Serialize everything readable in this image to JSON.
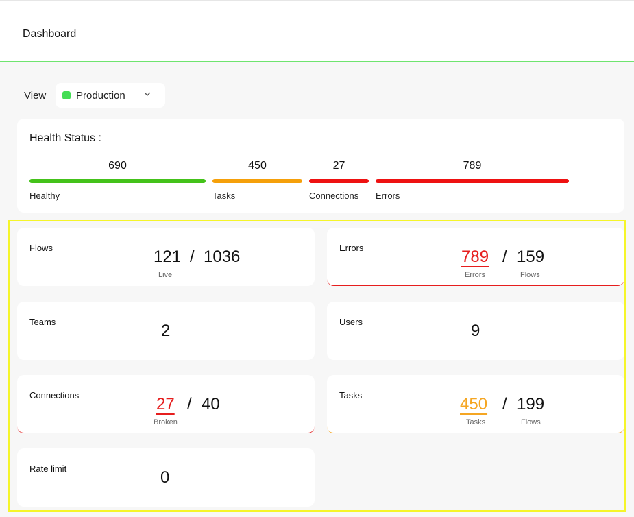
{
  "header": {
    "title": "Dashboard"
  },
  "view": {
    "label": "View",
    "selected": "Production",
    "status_color": "#44dd55"
  },
  "health": {
    "title": "Health Status :",
    "segments": [
      {
        "value": "690",
        "label": "Healthy",
        "color": "#44c21a"
      },
      {
        "value": "450",
        "label": "Tasks",
        "color": "#f5a00a"
      },
      {
        "value": "27",
        "label": "Connections",
        "color": "#ee1111"
      },
      {
        "value": "789",
        "label": "Errors",
        "color": "#ee1111"
      }
    ]
  },
  "cards": {
    "flows": {
      "title": "Flows",
      "value": "121",
      "slash": "/",
      "total": "1036",
      "sub": "Live"
    },
    "errors": {
      "title": "Errors",
      "value": "789",
      "slash": "/",
      "total": "159",
      "sub1": "Errors",
      "sub2": "Flows"
    },
    "teams": {
      "title": "Teams",
      "value": "2"
    },
    "users": {
      "title": "Users",
      "value": "9"
    },
    "connections": {
      "title": "Connections",
      "value": "27",
      "slash": "/",
      "total": "40",
      "sub": "Broken"
    },
    "tasks": {
      "title": "Tasks",
      "value": "450",
      "slash": "/",
      "total": "199",
      "sub1": "Tasks",
      "sub2": "Flows"
    },
    "rate_limit": {
      "title": "Rate limit",
      "value": "0"
    }
  }
}
